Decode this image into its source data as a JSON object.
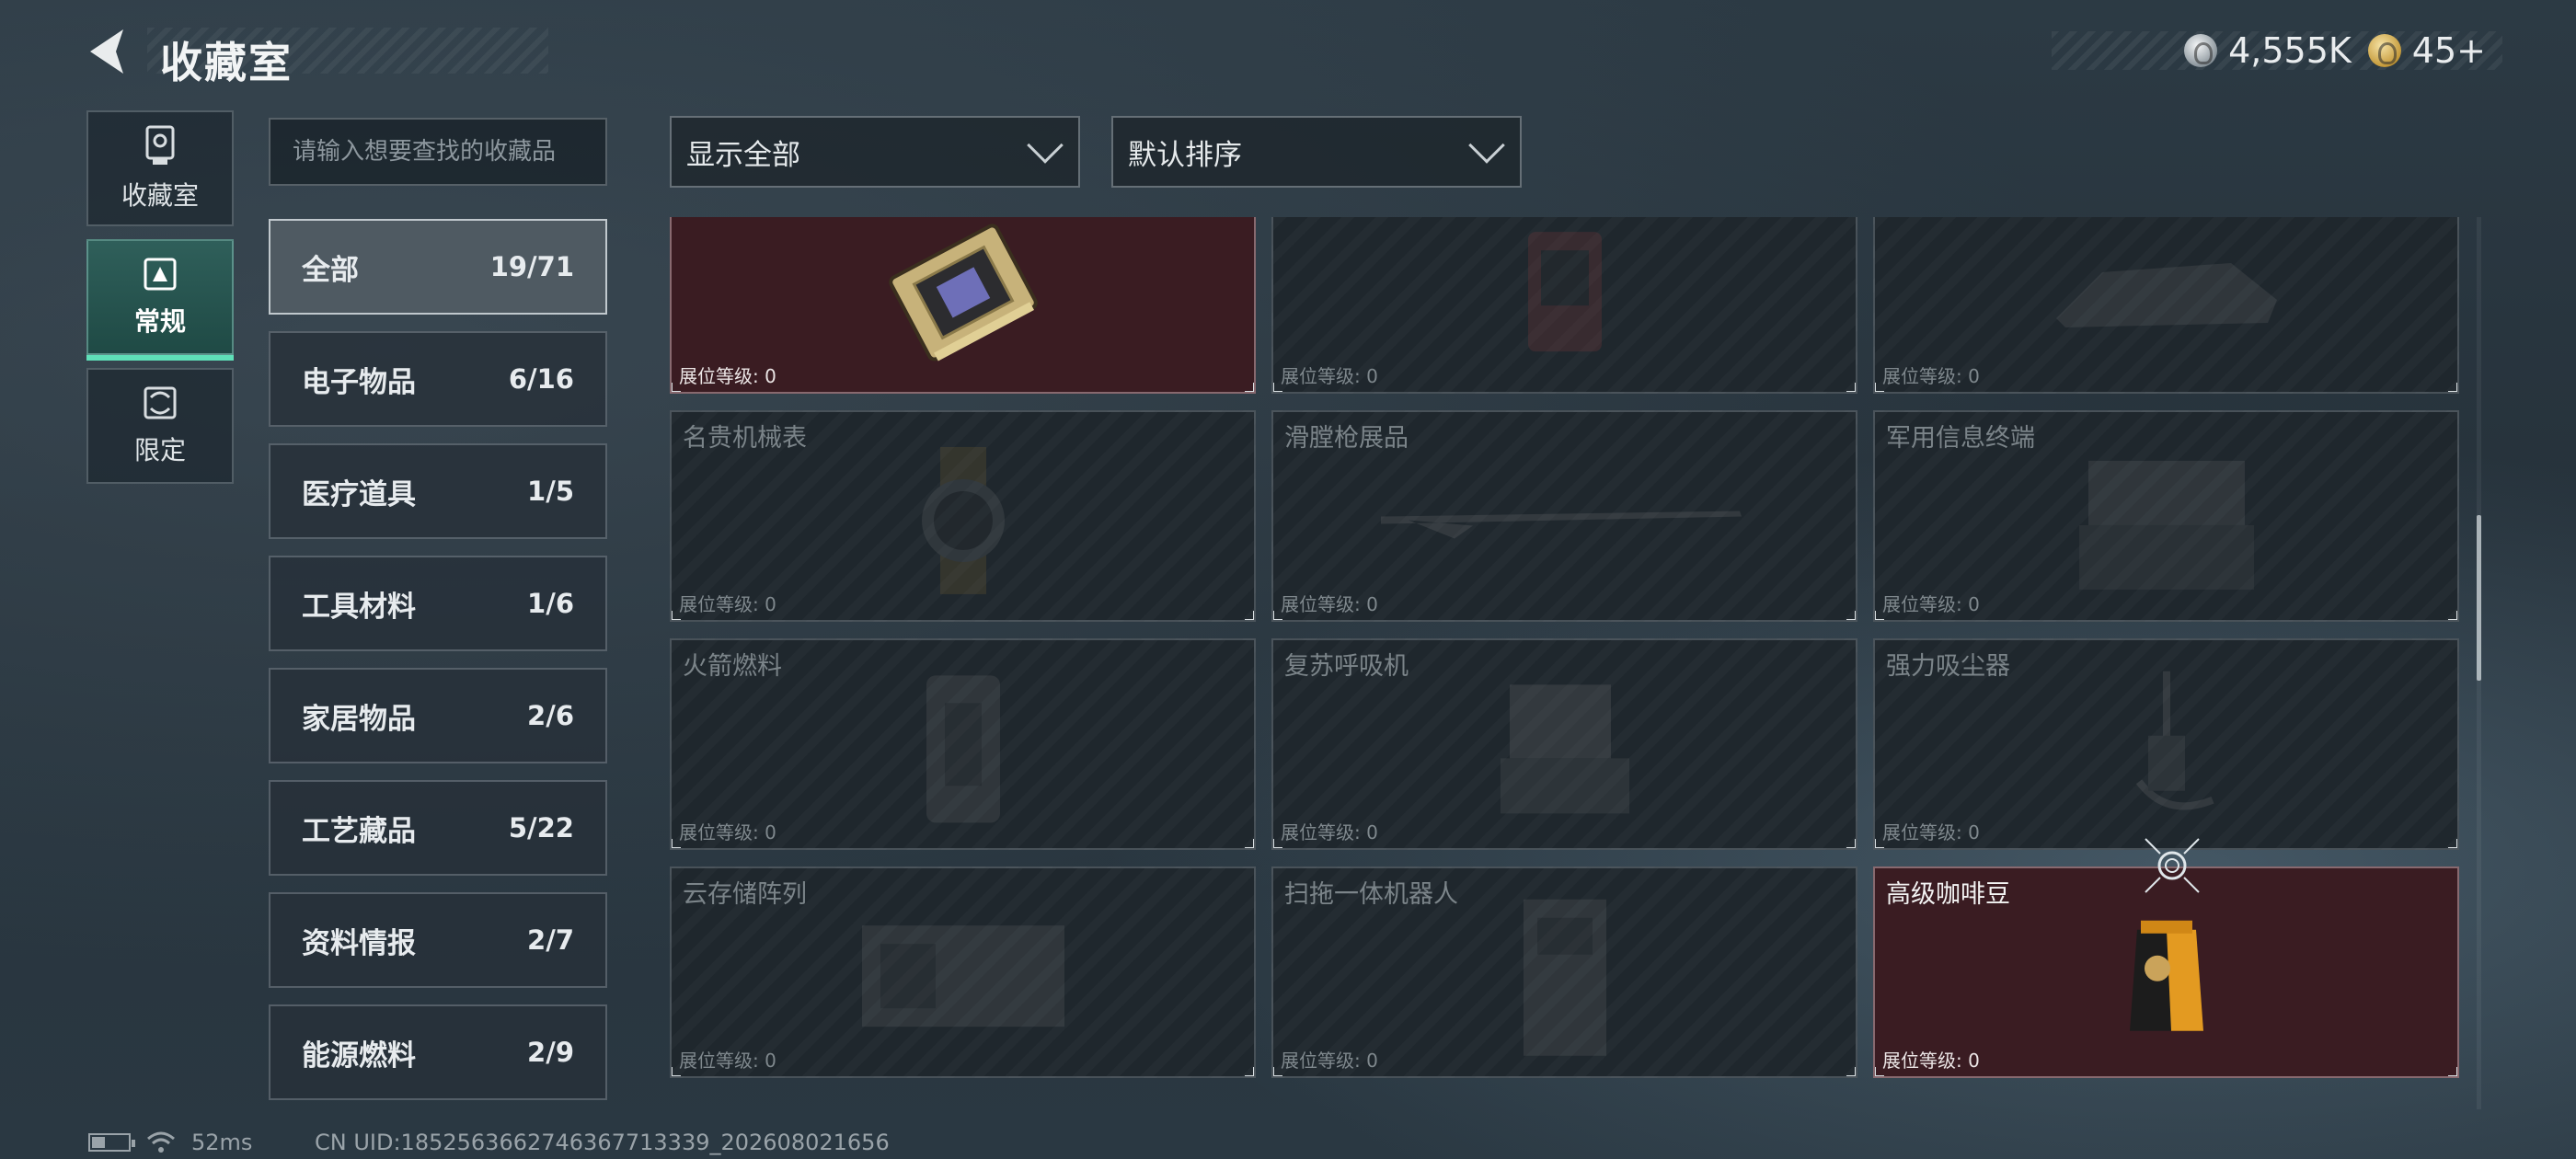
{
  "header": {
    "title": "收藏室"
  },
  "currency": {
    "silver": "4,555K",
    "gold": "45+"
  },
  "rail": [
    {
      "label": "收藏室",
      "icon": "trophy-icon",
      "active": false
    },
    {
      "label": "常规",
      "icon": "regular-collection-icon",
      "active": true
    },
    {
      "label": "限定",
      "icon": "limited-collection-icon",
      "active": false
    }
  ],
  "search": {
    "placeholder": "请输入想要查找的收藏品"
  },
  "filters": {
    "show": "显示全部",
    "sort": "默认排序"
  },
  "categories": [
    {
      "label": "全部",
      "count": "19/71"
    },
    {
      "label": "电子物品",
      "count": "6/16"
    },
    {
      "label": "医疗道具",
      "count": "1/5"
    },
    {
      "label": "工具材料",
      "count": "1/6"
    },
    {
      "label": "家居物品",
      "count": "2/6"
    },
    {
      "label": "工艺藏品",
      "count": "5/22"
    },
    {
      "label": "资料情报",
      "count": "2/7"
    },
    {
      "label": "能源燃料",
      "count": "2/9"
    }
  ],
  "level_label": "展位等级: 0",
  "items": [
    {
      "name": "",
      "owned": true,
      "art": "gpu-card-icon"
    },
    {
      "name": "",
      "owned": false,
      "art": "device-icon"
    },
    {
      "name": "",
      "owned": false,
      "art": "vehicle-model-icon"
    },
    {
      "name": "名贵机械表",
      "owned": false,
      "art": "watch-icon"
    },
    {
      "name": "滑膛枪展品",
      "owned": false,
      "art": "musket-icon"
    },
    {
      "name": "军用信息终端",
      "owned": false,
      "art": "terminal-case-icon"
    },
    {
      "name": "火箭燃料",
      "owned": false,
      "art": "fuel-canister-icon"
    },
    {
      "name": "复苏呼吸机",
      "owned": false,
      "art": "ventilator-icon"
    },
    {
      "name": "强力吸尘器",
      "owned": false,
      "art": "vacuum-icon"
    },
    {
      "name": "云存储阵列",
      "owned": false,
      "art": "storage-array-icon"
    },
    {
      "name": "扫拖一体机器人",
      "owned": false,
      "art": "robot-icon"
    },
    {
      "name": "高级咖啡豆",
      "owned": true,
      "art": "coffee-bag-icon"
    }
  ],
  "status": {
    "ping": "52ms",
    "uid": "CN UID:1852563662746367713339_202608021656"
  }
}
